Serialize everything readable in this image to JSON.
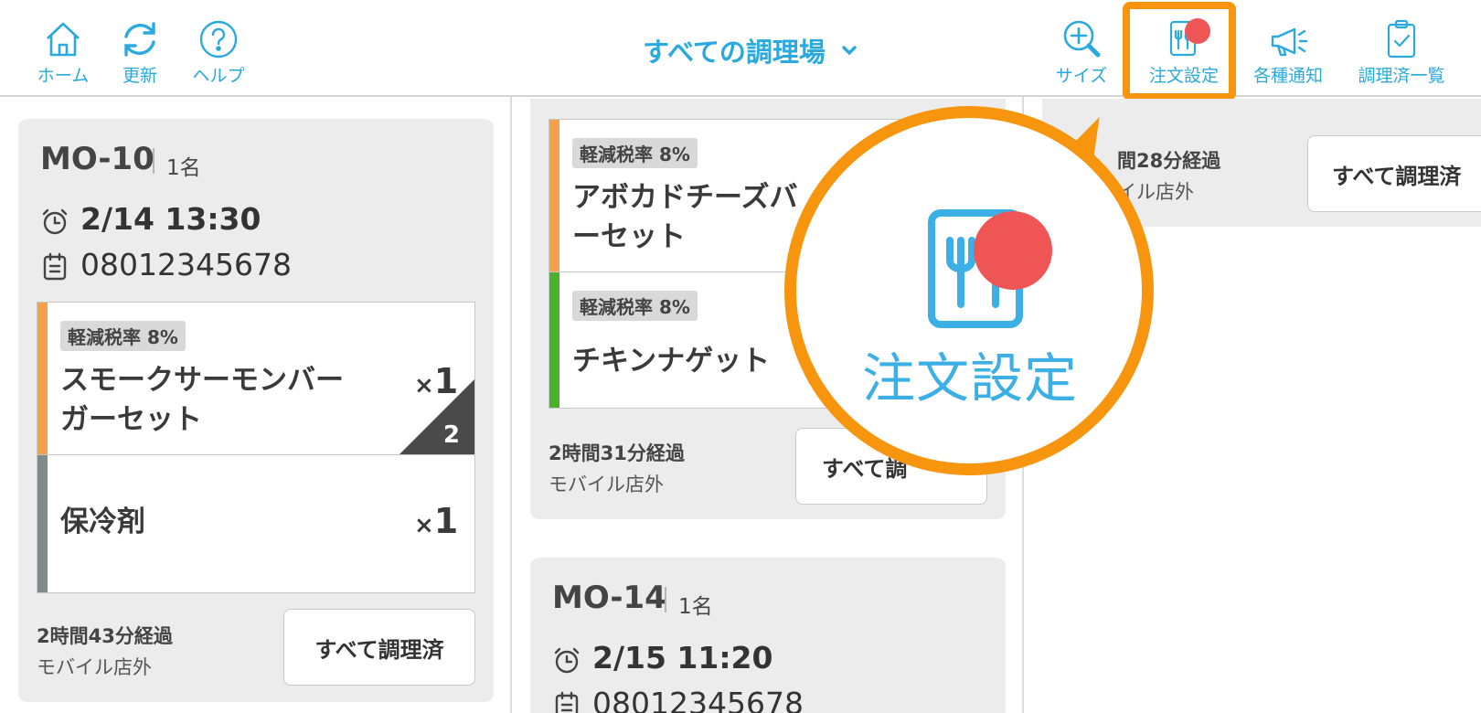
{
  "toolbar": {
    "home": "ホーム",
    "refresh": "更新",
    "help": "ヘルプ",
    "kitchen_selector": "すべての調理場",
    "size": "サイズ",
    "order_settings": "注文設定",
    "notifications": "各種通知",
    "cooked_list": "調理済一覧"
  },
  "colors": {
    "accent": "#2aa9df",
    "highlight": "#f7950f",
    "badge": "#ef5555",
    "bar_orange": "#f4a04a",
    "bar_green": "#4bb02a",
    "bar_gray": "#7f8c8a"
  },
  "columns": [
    {
      "order_no": "MO-10",
      "people": "1名",
      "time": "2/14 13:30",
      "phone": "08012345678",
      "items": [
        {
          "tax": "軽減税率 8%",
          "name_lines": [
            "スモークサーモンバー",
            "ガーセット"
          ],
          "qty_x": "×",
          "qty": "1",
          "corner": "2"
        },
        {
          "tax": "",
          "name_lines": [
            "保冷剤"
          ],
          "qty_x": "×",
          "qty": "1"
        }
      ],
      "elapsed": "2時間43分経過",
      "channel": "モバイル店外",
      "done": "すべて調理済"
    },
    {
      "items": [
        {
          "tax": "軽減税率 8%",
          "name_lines": [
            "アボカドチーズバ",
            "ーセット"
          ]
        },
        {
          "tax": "軽減税率 8%",
          "name_lines": [
            "チキンナゲット"
          ]
        }
      ],
      "elapsed": "2時間31分経過",
      "channel": "モバイル店外",
      "done": "すべて調"
    },
    {
      "order_no": "MO-14",
      "people": "1名",
      "time": "2/15 11:20",
      "phone": "08012345678"
    },
    {
      "elapsed": "間28分経過",
      "channel": "イル店外",
      "done": "すべて調理済"
    }
  ],
  "callout": {
    "label": "注文設定",
    "icon": "order-settings-icon"
  }
}
